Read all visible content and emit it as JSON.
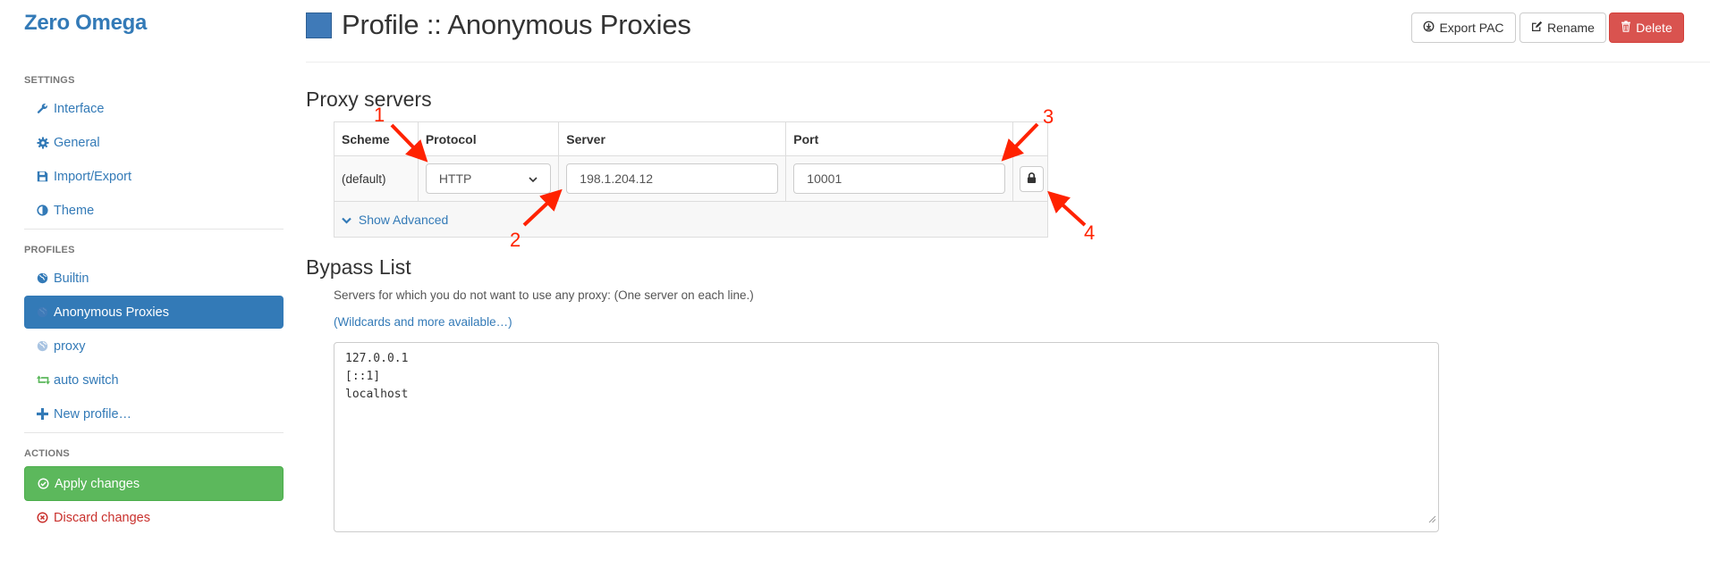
{
  "app": {
    "title": "Zero Omega"
  },
  "sidebar": {
    "settings_header": "SETTINGS",
    "settings": [
      {
        "label": "Interface",
        "icon": "wrench-icon"
      },
      {
        "label": "General",
        "icon": "gear-icon"
      },
      {
        "label": "Import/Export",
        "icon": "floppy-disk-icon"
      },
      {
        "label": "Theme",
        "icon": "half-circle-icon"
      }
    ],
    "profiles_header": "PROFILES",
    "profiles": [
      {
        "label": "Builtin",
        "icon": "globe-icon"
      },
      {
        "label": "Anonymous Proxies",
        "icon": "globe-icon",
        "active": true
      },
      {
        "label": "proxy",
        "icon": "globe-icon"
      },
      {
        "label": "auto switch",
        "icon": "retweet-icon"
      },
      {
        "label": "New profile…",
        "icon": "plus-icon"
      }
    ],
    "actions_header": "ACTIONS",
    "actions": [
      {
        "label": "Apply changes",
        "icon": "check-circle-icon"
      },
      {
        "label": "Discard changes",
        "icon": "remove-circle-icon"
      }
    ]
  },
  "header": {
    "title": "Profile :: Anonymous Proxies",
    "profile_color": "#3f7ab8",
    "buttons": {
      "export": "Export PAC",
      "rename": "Rename",
      "delete": "Delete"
    }
  },
  "proxy": {
    "section_title": "Proxy servers",
    "columns": [
      "Scheme",
      "Protocol",
      "Server",
      "Port"
    ],
    "row": {
      "scheme": "(default)",
      "protocol": "HTTP",
      "server": "198.1.204.12",
      "port": "10001"
    },
    "show_advanced": "Show Advanced"
  },
  "bypass": {
    "section_title": "Bypass List",
    "help": "Servers for which you do not want to use any proxy: (One server on each line.)",
    "wildcards_link": "(Wildcards and more available…)",
    "lines": [
      "127.0.0.1",
      "[::1]",
      "localhost"
    ]
  },
  "annotations": {
    "labels": [
      "1",
      "2",
      "3",
      "4"
    ],
    "color": "#ff2200"
  },
  "colors": {
    "accent": "#337ab7",
    "success": "#5cb85c",
    "danger": "#d9534f"
  }
}
